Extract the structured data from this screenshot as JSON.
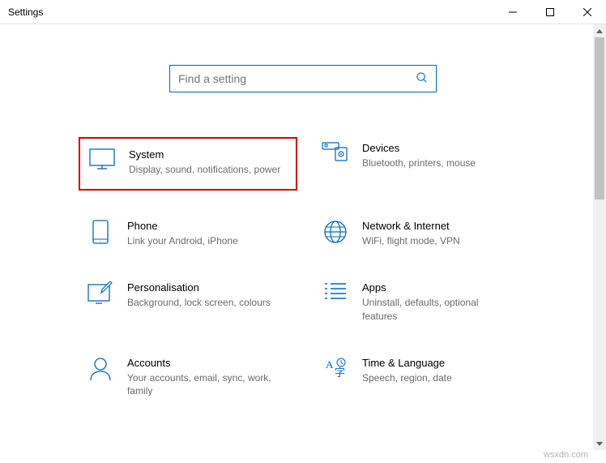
{
  "window": {
    "title": "Settings"
  },
  "search": {
    "placeholder": "Find a setting"
  },
  "tiles": {
    "system": {
      "title": "System",
      "desc": "Display, sound, notifications, power"
    },
    "devices": {
      "title": "Devices",
      "desc": "Bluetooth, printers, mouse"
    },
    "phone": {
      "title": "Phone",
      "desc": "Link your Android, iPhone"
    },
    "network": {
      "title": "Network & Internet",
      "desc": "WiFi, flight mode, VPN"
    },
    "personalisation": {
      "title": "Personalisation",
      "desc": "Background, lock screen, colours"
    },
    "apps": {
      "title": "Apps",
      "desc": "Uninstall, defaults, optional features"
    },
    "accounts": {
      "title": "Accounts",
      "desc": "Your accounts, email, sync, work, family"
    },
    "time": {
      "title": "Time & Language",
      "desc": "Speech, region, date"
    }
  },
  "watermark": "wsxdn.com"
}
